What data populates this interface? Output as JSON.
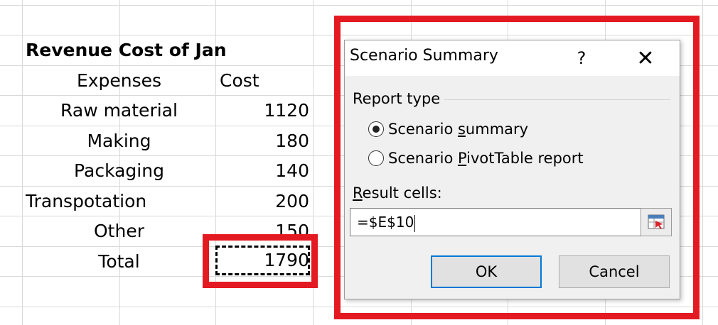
{
  "sheet": {
    "title": "Revenue Cost of Jan",
    "headers": {
      "expenses": "Expenses",
      "cost": "Cost"
    },
    "rows": [
      {
        "expense": "Raw material",
        "cost": "1120"
      },
      {
        "expense": "Making",
        "cost": "180"
      },
      {
        "expense": "Packaging",
        "cost": "140"
      },
      {
        "expense": "Transpotation",
        "cost": "200"
      },
      {
        "expense": "Other",
        "cost": "150"
      },
      {
        "expense": "Total",
        "cost": "1790"
      }
    ]
  },
  "dialog": {
    "title": "Scenario Summary",
    "help": "?",
    "close": "✕",
    "report_type_label": "Report type",
    "options": [
      {
        "pre": "Scenario ",
        "accel": "s",
        "post": "ummary",
        "checked": true
      },
      {
        "pre": "Scenario ",
        "accel": "P",
        "post": "ivotTable report",
        "checked": false
      }
    ],
    "result_cells": {
      "accel": "R",
      "rest": "esult cells:",
      "value": "=$E$10"
    },
    "ok_label": "OK",
    "cancel_label": "Cancel"
  },
  "colors": {
    "highlight": "#e41a23",
    "focus": "#0078d7"
  }
}
